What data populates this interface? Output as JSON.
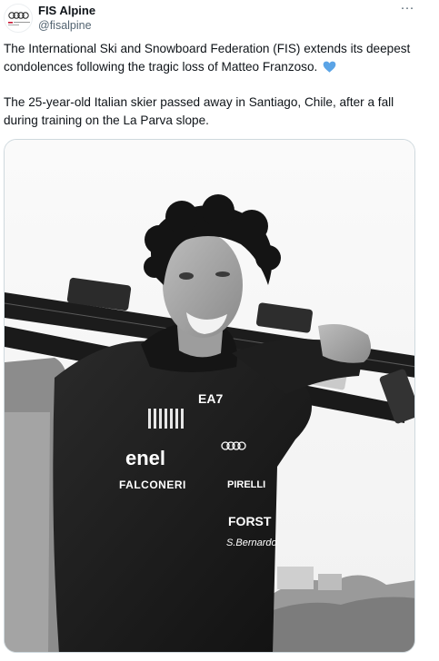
{
  "account": {
    "name": "FIS Alpine",
    "handle": "@fisalpine",
    "avatar_brand_text": "Audi FIS Ski World Cup"
  },
  "menu": {
    "more_icon": "more-horizontal-icon",
    "more_label": "···"
  },
  "tweet": {
    "paragraph_1": "The International Ski and Snowboard Federation (FIS) extends its deepest condolences following the tragic loss of Matteo Franzoso.",
    "paragraph_1_emoji": "blue-heart-icon",
    "paragraph_2": "The 25-year-old Italian skier passed away in Santiago, Chile, after a fall during training on the La Parva slope."
  },
  "media": {
    "type": "black-and-white photo",
    "jacket_logos": [
      "EA7",
      "enel",
      "FALCONERI",
      "Audi",
      "PIRELLI",
      "FORST",
      "S.Bernardo"
    ]
  },
  "colors": {
    "text": "#0f1419",
    "secondary_text": "#536471",
    "border": "#cfd9de",
    "heart": "#5ba4e6"
  }
}
